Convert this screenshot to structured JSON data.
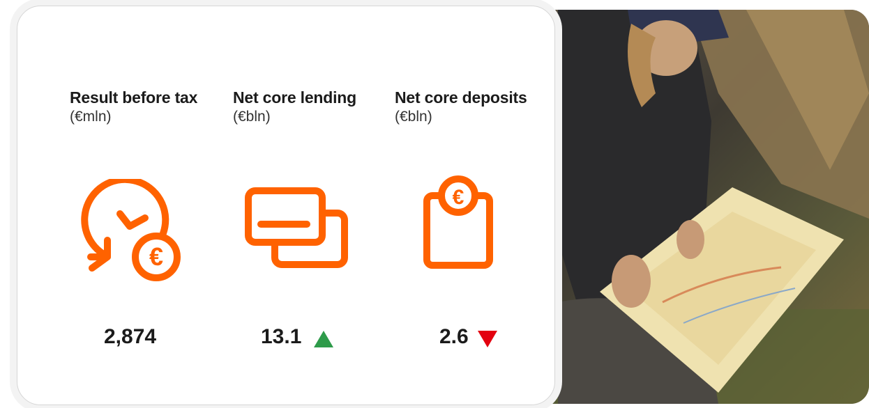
{
  "colors": {
    "accent": "#FF6200",
    "up": "#2E9B4A",
    "down": "#E3000F",
    "text": "#1B1B1B"
  },
  "kpis": [
    {
      "title": "Result before tax",
      "unit": "(€mln)",
      "value": "2,874",
      "icon": "clock-euro-icon",
      "trend": "none"
    },
    {
      "title": "Net core lending",
      "unit": "(€bln)",
      "value": "13.1",
      "icon": "credit-cards-icon",
      "trend": "up"
    },
    {
      "title": "Net core deposits",
      "unit": "(€bln)",
      "value": "2.6",
      "icon": "euro-deposit-box-icon",
      "trend": "down"
    }
  ]
}
